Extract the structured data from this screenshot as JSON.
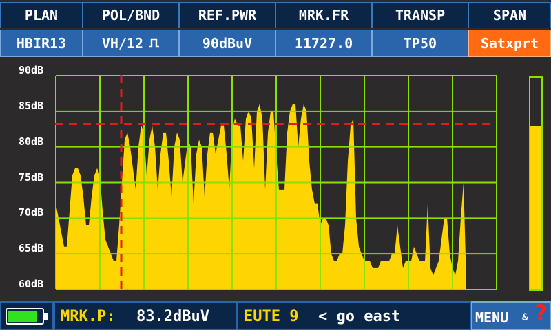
{
  "header": {
    "columns": [
      {
        "label": "PLAN",
        "value": "HBIR13"
      },
      {
        "label": "POL/BND",
        "value": "VH/12"
      },
      {
        "label": "REF.PWR",
        "value": "90dBuV"
      },
      {
        "label": "MRK.FR",
        "value": "11727.0"
      },
      {
        "label": "TRANSP",
        "value": "TP50"
      },
      {
        "label": "SPAN",
        "value": "Satxprt"
      }
    ],
    "icons": {
      "band": "pulse-icon"
    }
  },
  "chart_data": {
    "type": "area",
    "ylim": [
      60,
      90
    ],
    "yticks": [
      "90dB",
      "85dB",
      "80dB",
      "75dB",
      "70dB",
      "65dB",
      "60dB"
    ],
    "x": [
      0,
      4,
      8,
      12,
      16,
      20,
      24,
      28,
      32,
      36,
      40,
      44,
      48,
      52,
      56,
      60,
      64,
      68,
      72,
      76,
      80,
      84,
      88,
      92,
      96,
      100,
      104,
      108,
      112,
      116,
      120,
      124,
      128,
      132,
      136,
      140,
      144,
      148,
      152,
      156,
      160,
      164,
      168,
      172,
      176,
      180,
      184,
      188,
      192,
      196,
      200,
      204,
      208,
      212,
      216,
      220,
      224,
      228,
      232,
      236,
      240,
      244,
      248,
      252,
      256,
      260,
      264,
      268,
      272,
      276,
      280,
      284,
      288,
      292,
      296,
      300,
      304,
      308,
      312,
      316,
      320,
      324,
      328,
      332,
      336,
      340,
      344,
      348,
      352,
      356,
      360,
      364,
      368,
      372,
      376,
      380,
      384,
      388,
      392,
      396,
      400,
      404,
      408,
      412,
      416,
      420,
      424,
      428,
      432,
      436,
      440,
      444,
      448,
      452,
      456,
      460,
      464,
      468,
      472,
      476,
      480,
      484,
      488,
      492,
      496,
      500,
      504,
      508,
      512,
      516,
      520,
      524,
      528,
      532,
      536,
      540,
      544,
      548,
      552,
      556,
      560,
      564,
      568,
      572,
      576,
      580,
      584,
      588,
      592,
      596
    ],
    "values": [
      72,
      70,
      68,
      66,
      66,
      71,
      76,
      77,
      77,
      76,
      73,
      69,
      69,
      73,
      76,
      77,
      76,
      71,
      67,
      66,
      65,
      64,
      64,
      69,
      75,
      81,
      82,
      80,
      77,
      74,
      80,
      83,
      82,
      76,
      81,
      83,
      80,
      74,
      79,
      82,
      82,
      78,
      73,
      80,
      82,
      81,
      75,
      78,
      81,
      80,
      72,
      79,
      81,
      80,
      73,
      79,
      82,
      82,
      79,
      81,
      83,
      83,
      79,
      74,
      82,
      84,
      83,
      83,
      78,
      84,
      85,
      84,
      77,
      85,
      86,
      84,
      74,
      82,
      85,
      85,
      79,
      74,
      74,
      74,
      82,
      85,
      86,
      86,
      80,
      84,
      86,
      85,
      78,
      74,
      72,
      72,
      69,
      70,
      70,
      69,
      65,
      64,
      64,
      65,
      65,
      69,
      78,
      83,
      84,
      70,
      66,
      65,
      64,
      64,
      64,
      63,
      63,
      63,
      64,
      64,
      64,
      64,
      65,
      65,
      69,
      66,
      63,
      64,
      64,
      64,
      66,
      65,
      64,
      64,
      64,
      72,
      63,
      62,
      63,
      64,
      67,
      70,
      70,
      65,
      63,
      62,
      64,
      70,
      75,
      61
    ],
    "marker": {
      "x_index": 23,
      "level_db": 83.2
    }
  },
  "level_meter": {
    "fraction": 0.77
  },
  "footer": {
    "battery": {
      "icon": "battery-icon",
      "charge": 0.85
    },
    "marker_label": "MRK.P:",
    "marker_value": "83.2dBuV",
    "satellite": "EUTE 9",
    "message": "< go east",
    "menu_label": "MENU",
    "menu_amp": "&",
    "help_glyph": "?"
  },
  "colors": {
    "header_top": "#0b2547",
    "header_bottom": "#2a64ab",
    "accent_orange": "#ff6a12",
    "grid": "#8be000",
    "trace": "#ffd500",
    "marker": "#e21b1b",
    "background": "#2d2a2c",
    "label_yellow": "#ffd500"
  }
}
